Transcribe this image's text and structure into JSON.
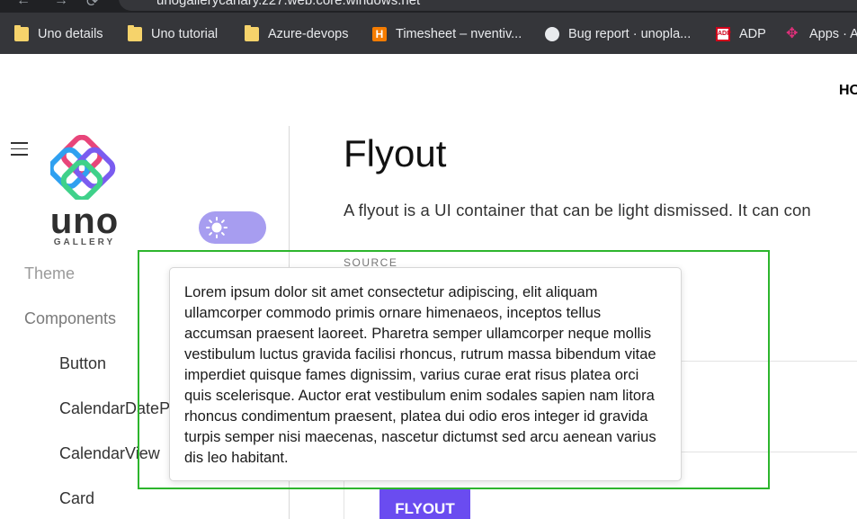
{
  "browser": {
    "url": "unogallerycanary.z27.web.core.windows.net",
    "bookmarks": [
      {
        "label": "Uno details",
        "icon": "folder-icon"
      },
      {
        "label": "Uno tutorial",
        "icon": "folder-icon"
      },
      {
        "label": "Azure-devops",
        "icon": "folder-icon"
      },
      {
        "label": "Timesheet – nventiv...",
        "icon": "h-logo-icon"
      },
      {
        "label": "Bug report · unopla...",
        "icon": "github-icon"
      },
      {
        "label": "ADP",
        "icon": "adp-icon"
      },
      {
        "label": "Apps · A",
        "icon": "apps-icon"
      }
    ]
  },
  "header": {
    "nav_partial": "HO"
  },
  "sidebar": {
    "logo_text": "uno",
    "logo_sub": "GALLERY",
    "theme_item": "Theme",
    "components_heading": "Components",
    "items": [
      "Button",
      "CalendarDatePi",
      "CalendarView",
      "Card"
    ]
  },
  "main": {
    "title": "Flyout",
    "description": "A flyout is a UI container that can be light dismissed. It can con",
    "source_label": "SOURCE",
    "flyout_button": "FLYOUT"
  },
  "flyout": {
    "text": " Lorem ipsum dolor sit amet consectetur adipiscing, elit aliquam ullamcorper commodo primis ornare himenaeos, inceptos tellus accumsan praesent laoreet. Pharetra semper ullamcorper neque mollis vestibulum luctus gravida facilisi rhoncus, rutrum massa bibendum vitae imperdiet quisque fames dignissim, varius curae erat risus platea orci quis scelerisque. Auctor erat vestibulum enim sodales sapien nam litora rhoncus condimentum praesent, platea dui odio eros integer id gravida turpis semper nisi maecenas, nascetur dictumst sed arcu aenean varius dis leo habitant."
  },
  "colors": {
    "accent": "#6a4cf0",
    "theme_toggle": "#a79df0",
    "highlight_box": "#2db52d"
  }
}
